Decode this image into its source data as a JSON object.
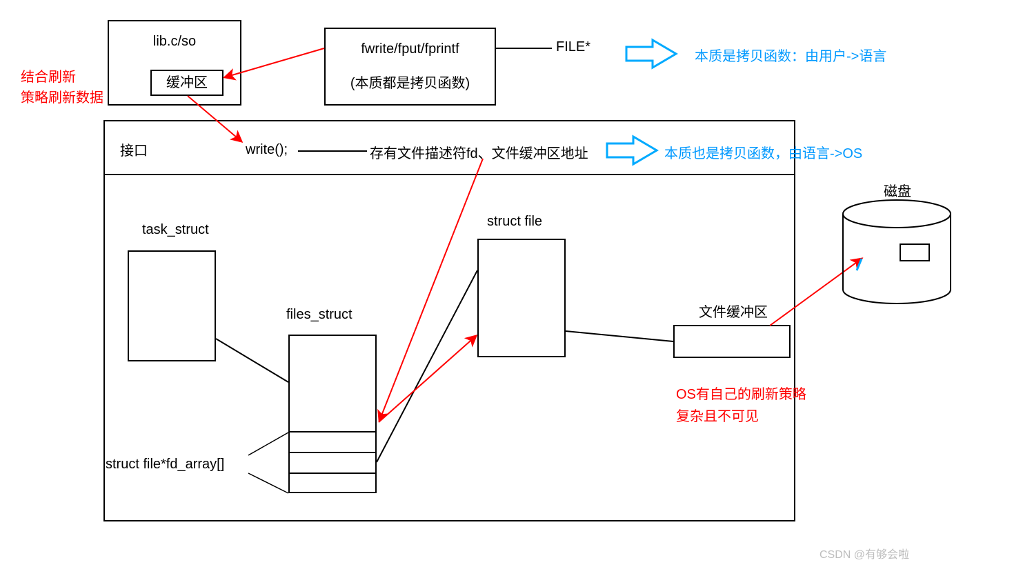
{
  "top": {
    "libBox": "lib.c/so",
    "bufferBox": "缓冲区",
    "fwriteLine1": "fwrite/fput/fprintf",
    "fwriteLine2": "(本质都是拷贝函数)",
    "filePtr": "FILE*",
    "blueNote1": "本质是拷贝函数：由用户->语言",
    "redNote1a": "结合刷新",
    "redNote1b": "策略刷新数据"
  },
  "api": {
    "label": "接口",
    "write": "write();",
    "writeDesc": "存有文件描述符fd、文件缓冲区地址",
    "blueNote2": "本质也是拷贝函数，由语言->OS"
  },
  "kernel": {
    "taskStruct": "task_struct",
    "filesStruct": "files_struct",
    "fdArray": "struct file*fd_array[]",
    "structFile": "struct file",
    "fileBuffer": "文件缓冲区",
    "osNote1": "OS有自己的刷新策略",
    "osNote2": "复杂且不可见"
  },
  "disk": {
    "label": "磁盘"
  },
  "watermark": "CSDN @有够会啦"
}
